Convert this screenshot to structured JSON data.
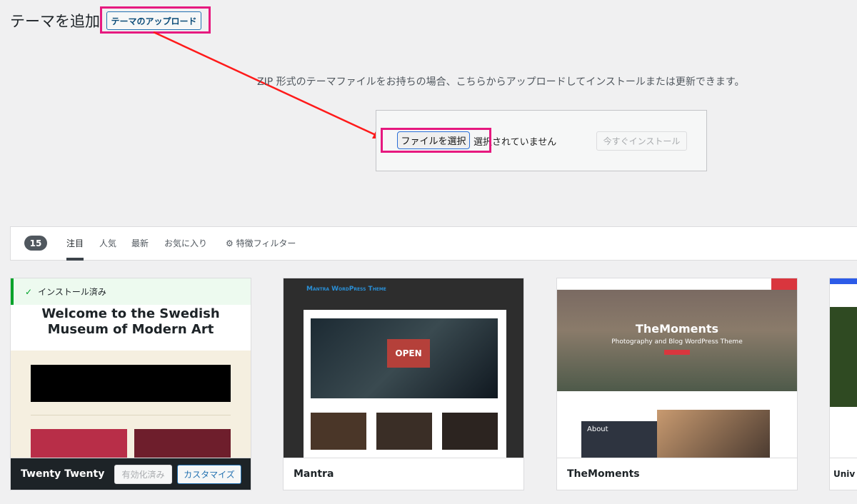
{
  "header": {
    "title": "テーマを追加",
    "upload_button": "テーマのアップロード"
  },
  "upload": {
    "help_text": "ZIP 形式のテーマファイルをお持ちの場合、こちらからアップロードしてインストールまたは更新できます。",
    "file_button": "ファイルを選択",
    "file_status": "選択されていません",
    "install_button": "今すぐインストール"
  },
  "filter": {
    "count": "15",
    "tabs": [
      "注目",
      "人気",
      "最新",
      "お気に入り"
    ],
    "feature_filter": "特徴フィルター",
    "active_tab": "注目"
  },
  "themes": [
    {
      "name": "Twenty Twenty",
      "installed_label": "インストール済み",
      "preview_title": "Welcome to the Swedish Museum of Modern Art",
      "activated_label": "有効化済み",
      "customize_label": "カスタマイズ"
    },
    {
      "name": "Mantra",
      "preview_title": "Mantra WordPress Theme"
    },
    {
      "name": "TheMoments",
      "preview_title": "TheMoments",
      "preview_subtitle": "Photography and Blog WordPress Theme",
      "preview_section": "About"
    },
    {
      "name": "Univ"
    }
  ],
  "colors": {
    "highlight": "#e6197f",
    "arrow": "#ff1a1a",
    "accent": "#2271b1"
  }
}
